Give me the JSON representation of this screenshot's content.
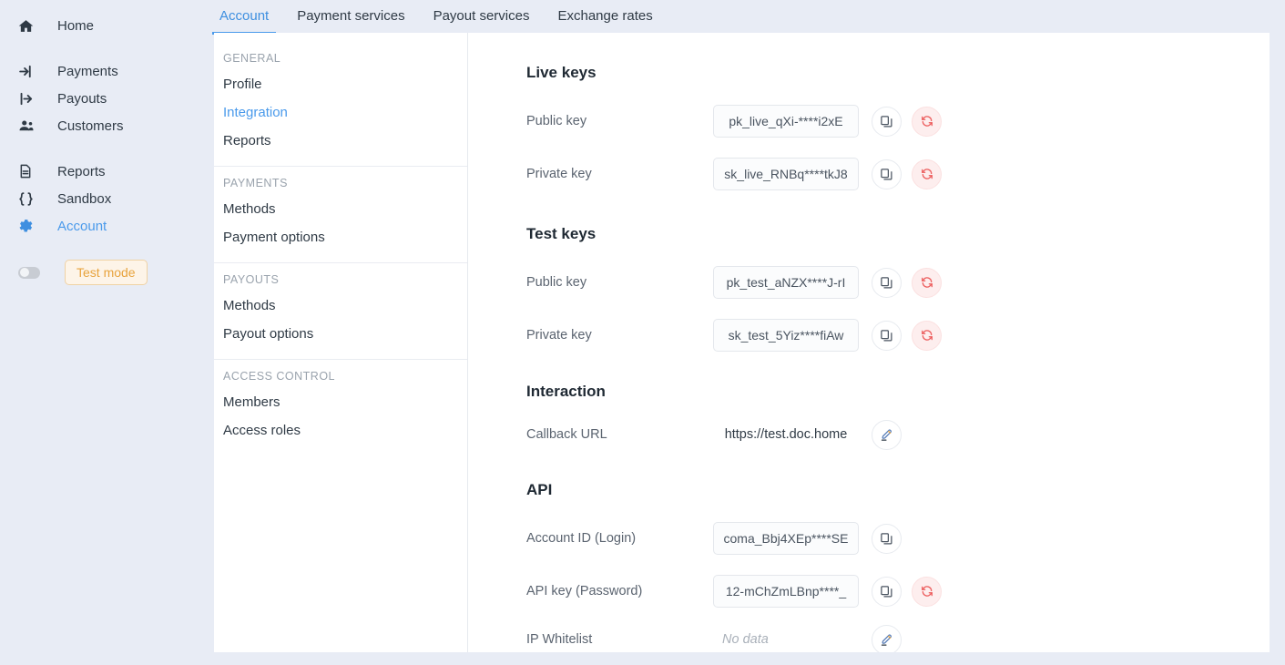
{
  "left_rail": {
    "items": [
      {
        "label": "Home",
        "icon": "home-icon",
        "active": false
      },
      {
        "label": "Payments",
        "icon": "arrow-into-bracket-icon",
        "active": false
      },
      {
        "label": "Payouts",
        "icon": "arrow-out-of-bracket-icon",
        "active": false
      },
      {
        "label": "Customers",
        "icon": "users-icon",
        "active": false
      },
      {
        "label": "Reports",
        "icon": "document-icon",
        "active": false
      },
      {
        "label": "Sandbox",
        "icon": "curly-braces-icon",
        "active": false
      },
      {
        "label": "Account",
        "icon": "gear-icon",
        "active": true
      }
    ],
    "test_mode": {
      "label": "Test mode",
      "toggle_state": "off",
      "badge_color": "#e8a33d"
    }
  },
  "top_tabs": [
    {
      "label": "Account",
      "active": true
    },
    {
      "label": "Payment services",
      "active": false
    },
    {
      "label": "Payout services",
      "active": false
    },
    {
      "label": "Exchange rates",
      "active": false
    }
  ],
  "subnav": [
    {
      "title": "GENERAL",
      "items": [
        {
          "label": "Profile",
          "active": false
        },
        {
          "label": "Integration",
          "active": true
        },
        {
          "label": "Reports",
          "active": false
        }
      ]
    },
    {
      "title": "PAYMENTS",
      "items": [
        {
          "label": "Methods",
          "active": false
        },
        {
          "label": "Payment options",
          "active": false
        }
      ]
    },
    {
      "title": "PAYOUTS",
      "items": [
        {
          "label": "Methods",
          "active": false
        },
        {
          "label": "Payout options",
          "active": false
        }
      ]
    },
    {
      "title": "ACCESS CONTROL",
      "items": [
        {
          "label": "Members",
          "active": false
        },
        {
          "label": "Access roles",
          "active": false
        }
      ]
    }
  ],
  "content": {
    "live_keys": {
      "title": "Live keys",
      "public_label": "Public key",
      "public_value": "pk_live_qXi-****i2xE",
      "private_label": "Private key",
      "private_value": "sk_live_RNBq****tkJ8"
    },
    "test_keys": {
      "title": "Test keys",
      "public_label": "Public key",
      "public_value": "pk_test_aNZX****J-rI",
      "private_label": "Private key",
      "private_value": "sk_test_5Yiz****fiAw"
    },
    "interaction": {
      "title": "Interaction",
      "callback_label": "Callback URL",
      "callback_value": "https://test.doc.home"
    },
    "api": {
      "title": "API",
      "account_id_label": "Account ID (Login)",
      "account_id_value": "coma_Bbj4XEp****SE",
      "api_key_label": "API key (Password)",
      "api_key_value": "12-mChZmLBnp****_",
      "ip_whitelist_label": "IP Whitelist",
      "ip_whitelist_value": "No data"
    }
  },
  "colors": {
    "accent": "#4a9aeb",
    "danger": "#ec5c5c",
    "page_bg": "#e8ecf5",
    "panel_bg": "#ffffff"
  }
}
